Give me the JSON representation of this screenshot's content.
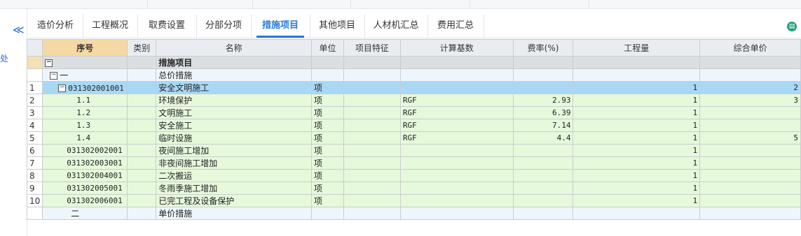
{
  "sidebar": {
    "collapse_glyph": "≪",
    "fragment": "处"
  },
  "tabs": [
    {
      "label": "造价分析"
    },
    {
      "label": "工程概况"
    },
    {
      "label": "取费设置"
    },
    {
      "label": "分部分项"
    },
    {
      "label": "措施项目",
      "active": true
    },
    {
      "label": "其他项目"
    },
    {
      "label": "人材机汇总"
    },
    {
      "label": "费用汇总"
    }
  ],
  "top_icon": "book-icon",
  "columns": [
    "序号",
    "类别",
    "名称",
    "单位",
    "项目特征",
    "计算基数",
    "费率(%)",
    "工程量",
    "综合单价"
  ],
  "rows": [
    {
      "rn": "",
      "code": "",
      "name": "措施项目",
      "unit": "",
      "base": "",
      "rate": "",
      "qty": "",
      "price": ""
    },
    {
      "rn": "",
      "code": "一",
      "name": "总价措施",
      "unit": "",
      "base": "",
      "rate": "",
      "qty": "",
      "price": ""
    },
    {
      "rn": "1",
      "code": "031302001001",
      "name": "安全文明施工",
      "unit": "项",
      "base": "",
      "rate": "",
      "qty": "1",
      "price": "2"
    },
    {
      "rn": "2",
      "code": "1.1",
      "name": "环境保护",
      "unit": "项",
      "base": "RGF",
      "rate": "2.93",
      "qty": "1",
      "price": "3"
    },
    {
      "rn": "3",
      "code": "1.2",
      "name": "文明施工",
      "unit": "项",
      "base": "RGF",
      "rate": "6.39",
      "qty": "1",
      "price": ""
    },
    {
      "rn": "4",
      "code": "1.3",
      "name": "安全施工",
      "unit": "项",
      "base": "RGF",
      "rate": "7.14",
      "qty": "1",
      "price": ""
    },
    {
      "rn": "5",
      "code": "1.4",
      "name": "临时设施",
      "unit": "项",
      "base": "RGF",
      "rate": "4.4",
      "qty": "1",
      "price": "5"
    },
    {
      "rn": "6",
      "code": "031302002001",
      "name": "夜间施工增加",
      "unit": "项",
      "base": "",
      "rate": "",
      "qty": "1",
      "price": ""
    },
    {
      "rn": "7",
      "code": "031302003001",
      "name": "非夜间施工增加",
      "unit": "项",
      "base": "",
      "rate": "",
      "qty": "1",
      "price": ""
    },
    {
      "rn": "8",
      "code": "031302004001",
      "name": "二次搬运",
      "unit": "项",
      "base": "",
      "rate": "",
      "qty": "1",
      "price": ""
    },
    {
      "rn": "9",
      "code": "031302005001",
      "name": "冬雨季施工增加",
      "unit": "项",
      "base": "",
      "rate": "",
      "qty": "1",
      "price": ""
    },
    {
      "rn": "10",
      "code": "031302006001",
      "name": "已完工程及设备保护",
      "unit": "项",
      "base": "",
      "rate": "",
      "qty": "1",
      "price": ""
    },
    {
      "rn": "",
      "code": "二",
      "name": "单价措施",
      "unit": "",
      "base": "",
      "rate": "",
      "qty": "",
      "price": ""
    }
  ]
}
